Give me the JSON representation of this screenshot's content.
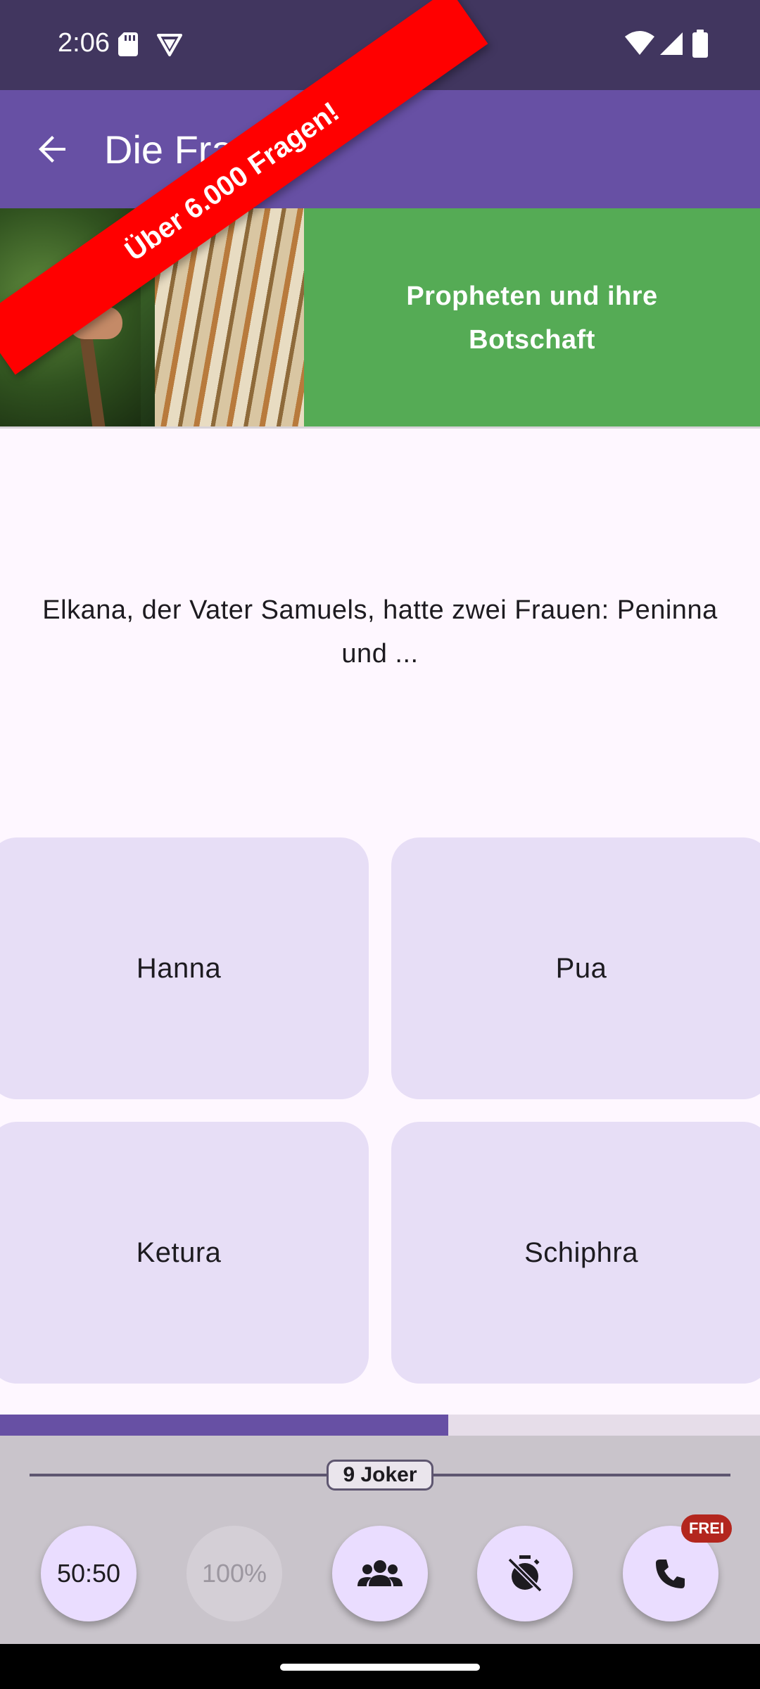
{
  "status_bar": {
    "time": "2:06",
    "icons": [
      "sd-card-icon",
      "vpn-shield-icon",
      "wifi-icon",
      "signal-icon",
      "battery-icon"
    ]
  },
  "app_bar": {
    "title": "Die Frage",
    "back_icon": "arrow-back-icon"
  },
  "ribbon": {
    "text": "Über 6.000 Fragen!",
    "color": "#FF0000"
  },
  "category": {
    "label": "Propheten und ihre Botschaft",
    "color": "#55AB55"
  },
  "question": {
    "text": "Elkana, der Vater Samuels, hatte zwei Frauen: Peninna und ..."
  },
  "answers": [
    {
      "label": "Hanna"
    },
    {
      "label": "Pua"
    },
    {
      "label": "Ketura"
    },
    {
      "label": "Schiphra"
    }
  ],
  "progress": {
    "fraction": 0.59
  },
  "jokers": {
    "count_label": "9 Joker",
    "items": [
      {
        "label": "50:50",
        "enabled": true
      },
      {
        "label": "100%",
        "enabled": false
      },
      {
        "icon": "group-icon",
        "enabled": true
      },
      {
        "icon": "timer-off-icon",
        "enabled": true
      },
      {
        "icon": "phone-icon",
        "enabled": true,
        "badge": "FREI"
      }
    ]
  },
  "colors": {
    "primary": "#6750A4",
    "status_bar": "#41365F",
    "answer_bg": "#E7DEF6"
  }
}
